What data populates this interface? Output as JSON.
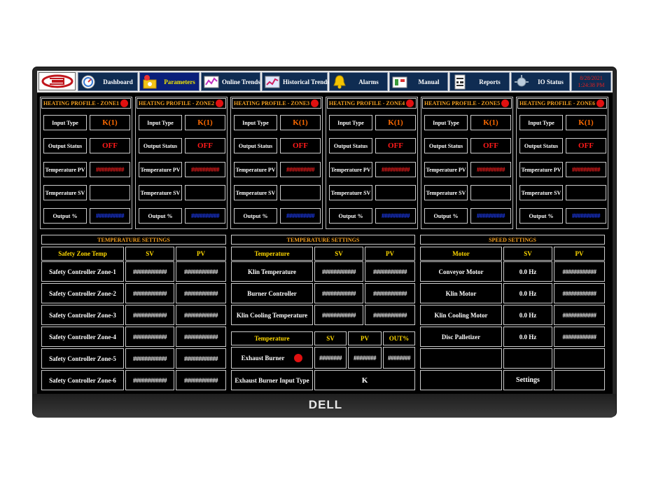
{
  "nav": {
    "items": [
      {
        "label": "Dashboard",
        "icon": "gauge-icon"
      },
      {
        "label": "Parameters",
        "icon": "parameters-icon"
      },
      {
        "label": "Online Trends",
        "icon": "online-trends-icon"
      },
      {
        "label": "Historical Trends",
        "icon": "historical-trends-icon"
      },
      {
        "label": "Alarms",
        "icon": "bell-icon"
      },
      {
        "label": "Manual",
        "icon": "manual-icon"
      },
      {
        "label": "Reports",
        "icon": "reports-icon"
      },
      {
        "label": "IO Status",
        "icon": "io-status-icon"
      }
    ],
    "active": "Parameters",
    "date": "8/28/2021",
    "time": "1:24:38 PM"
  },
  "zones": [
    {
      "title": "HEATING PROFILE - ZONE1",
      "input_type": "K(1)",
      "output_status": "OFF",
      "temperature_pv": "##########",
      "temperature_sv": "",
      "output_pct": "##########"
    },
    {
      "title": "HEATING PROFILE - ZONE2",
      "input_type": "K(1)",
      "output_status": "OFF",
      "temperature_pv": "##########",
      "temperature_sv": "",
      "output_pct": "##########"
    },
    {
      "title": "HEATING PROFILE - ZONE3",
      "input_type": "K(1)",
      "output_status": "OFF",
      "temperature_pv": "##########",
      "temperature_sv": "",
      "output_pct": "##########"
    },
    {
      "title": "HEATING PROFILE - ZONE4",
      "input_type": "K(1)",
      "output_status": "OFF",
      "temperature_pv": "##########",
      "temperature_sv": "",
      "output_pct": "##########"
    },
    {
      "title": "HEATING PROFILE - ZONE5",
      "input_type": "K(1)",
      "output_status": "OFF",
      "temperature_pv": "##########",
      "temperature_sv": "",
      "output_pct": "##########"
    },
    {
      "title": "HEATING PROFILE - ZONE6",
      "input_type": "K(1)",
      "output_status": "OFF",
      "temperature_pv": "##########",
      "temperature_sv": "",
      "output_pct": "##########"
    }
  ],
  "zone_labels": {
    "input_type": "Input Type",
    "output_status": "Output Status",
    "temperature_pv": "Temperature PV",
    "temperature_sv": "Temperature SV",
    "output_pct": "Output %"
  },
  "temp_settings_left": {
    "title": "TEMPERATURE SETTINGS",
    "headers": [
      "Safety Zone Temp",
      "SV",
      "PV"
    ],
    "rows": [
      {
        "name": "Safety Controller Zone-1",
        "sv": "############",
        "pv": "############"
      },
      {
        "name": "Safety Controller Zone-2",
        "sv": "############",
        "pv": "############"
      },
      {
        "name": "Safety Controller Zone-3",
        "sv": "############",
        "pv": "############"
      },
      {
        "name": "Safety Controller Zone-4",
        "sv": "############",
        "pv": "############"
      },
      {
        "name": "Safety Controller Zone-5",
        "sv": "############",
        "pv": "############"
      },
      {
        "name": "Safety Controller Zone-6",
        "sv": "############",
        "pv": "############"
      }
    ]
  },
  "temp_settings_mid": {
    "title": "TEMPERATURE SETTINGS",
    "headers": [
      "Temperature",
      "SV",
      "PV"
    ],
    "rows": [
      {
        "name": "Klin Temperature",
        "sv": "############",
        "pv": "############"
      },
      {
        "name": "Burner Controller",
        "sv": "############",
        "pv": "############"
      },
      {
        "name": "Klin Cooling Temperature",
        "sv": "############",
        "pv": "############"
      }
    ],
    "burner_headers": [
      "Temperature",
      "SV",
      "PV",
      "OUT%"
    ],
    "exhaust_burner": {
      "name": "Exhaust Burner",
      "sv": "########",
      "pv": "########",
      "out": "########"
    },
    "exhaust_input_type": {
      "name": "Exhaust Burner Input Type",
      "value": "K"
    }
  },
  "speed_settings": {
    "title": "SPEED SETTINGS",
    "headers": [
      "Motor",
      "SV",
      "PV"
    ],
    "rows": [
      {
        "name": "Conveyor Motor",
        "sv": "0.0 Hz",
        "pv": "############"
      },
      {
        "name": "Klin Motor",
        "sv": "0.0 Hz",
        "pv": "############"
      },
      {
        "name": "Klin Cooling Motor",
        "sv": "0.0 Hz",
        "pv": "############"
      },
      {
        "name": "Disc Palletizer",
        "sv": "0.0 Hz",
        "pv": "############"
      }
    ],
    "settings_button": "Settings"
  },
  "monitor_brand": "DELL",
  "colors": {
    "accent_orange": "#f4a020",
    "status_red": "#ff1a1a",
    "value_green": "#22ff22",
    "nav_blue": "#0f2c52",
    "settings_cyan": "#18d6e8"
  }
}
